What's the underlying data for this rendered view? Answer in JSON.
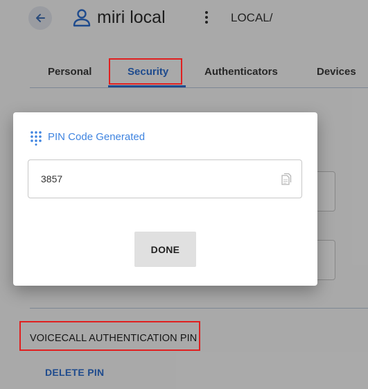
{
  "header": {
    "back_icon": "arrow-left-icon",
    "user_icon": "person-icon",
    "user_name": "miri local",
    "menu_icon": "more-vertical-icon",
    "realm": "LOCAL/"
  },
  "tabs": [
    {
      "label": "Personal",
      "active": false
    },
    {
      "label": "Security",
      "active": true
    },
    {
      "label": "Authenticators",
      "active": false
    },
    {
      "label": "Devices",
      "active": false
    }
  ],
  "section": {
    "title": "VOICECALL AUTHENTICATION PIN",
    "delete_label": "DELETE PIN"
  },
  "dialog": {
    "icon": "dialpad-icon",
    "title": "PIN Code Generated",
    "pin_value": "3857",
    "copy_icon": "copy-icon",
    "done_label": "DONE"
  },
  "colors": {
    "accent": "#2e6fd0",
    "title_accent": "#3f84e0",
    "highlight": "#e02020",
    "done_button_bg": "#e0e0e0"
  }
}
